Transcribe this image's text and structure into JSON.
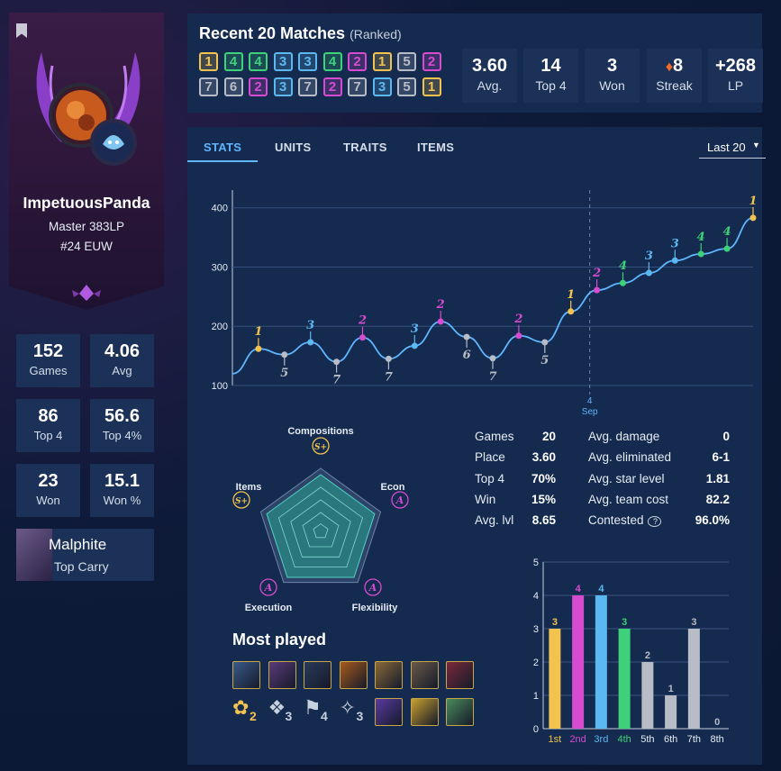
{
  "profile": {
    "name": "ImpetuousPanda",
    "rank": "Master 383LP",
    "ladder": "#24 EUW"
  },
  "profile_stats": [
    {
      "value": "152",
      "label": "Games"
    },
    {
      "value": "4.06",
      "label": "Avg"
    },
    {
      "value": "86",
      "label": "Top 4"
    },
    {
      "value": "56.6",
      "label": "Top 4%"
    },
    {
      "value": "23",
      "label": "Won"
    },
    {
      "value": "15.1",
      "label": "Won %"
    }
  ],
  "top_carry": {
    "name": "Malphite",
    "label": "Top Carry"
  },
  "recent": {
    "title": "Recent 20 Matches",
    "subtitle": "(Ranked)",
    "placements": [
      "1",
      "4",
      "4",
      "3",
      "3",
      "4",
      "2",
      "1",
      "5",
      "2",
      "7",
      "6",
      "2",
      "3",
      "7",
      "2",
      "7",
      "3",
      "5",
      "1"
    ]
  },
  "placement_colors": {
    "1": "#f2c34e",
    "2": "#d64bd0",
    "3": "#5cb8f0",
    "4": "#3ed17a",
    "5": "#b8bcc6",
    "6": "#b8bcc6",
    "7": "#b8bcc6",
    "8": "#b8bcc6"
  },
  "kpis": [
    {
      "value": "3.60",
      "label": "Avg."
    },
    {
      "value": "14",
      "label": "Top 4"
    },
    {
      "value": "3",
      "label": "Won"
    },
    {
      "value": "8",
      "label": "Streak",
      "icon": "fire-icon"
    },
    {
      "value": "+268",
      "label": "LP"
    }
  ],
  "tabs": [
    "STATS",
    "UNITS",
    "TRAITS",
    "ITEMS"
  ],
  "active_tab": "STATS",
  "range_select": "Last 20",
  "lp_chart": {
    "type": "line",
    "yticks": [
      "400",
      "300",
      "200",
      "100"
    ],
    "ylim": [
      100,
      430
    ],
    "date_label_day": "4",
    "date_label_month": "Sep",
    "lp": [
      120,
      162,
      152,
      173,
      140,
      181,
      145,
      167,
      208,
      182,
      146,
      184,
      173,
      225,
      261,
      273,
      290,
      311,
      322,
      331,
      383
    ],
    "placements": [
      null,
      "1",
      "5",
      "3",
      "7",
      "2",
      "7",
      "3",
      "2",
      "6",
      "7",
      "2",
      "5",
      "1",
      "2",
      "4",
      "3",
      "3",
      "4",
      "4",
      "1"
    ]
  },
  "radar": {
    "axes": [
      {
        "label": "Compositions",
        "grade": "S+"
      },
      {
        "label": "Econ",
        "grade": "A"
      },
      {
        "label": "Flexibility",
        "grade": "A"
      },
      {
        "label": "Execution",
        "grade": "A"
      },
      {
        "label": "Items",
        "grade": "S+"
      }
    ]
  },
  "stats_left": [
    {
      "label": "Games",
      "value": "20"
    },
    {
      "label": "Place",
      "value": "3.60"
    },
    {
      "label": "Top 4",
      "value": "70%"
    },
    {
      "label": "Win",
      "value": "15%"
    },
    {
      "label": "Avg. lvl",
      "value": "8.65"
    }
  ],
  "stats_right": [
    {
      "label": "Avg. damage",
      "value": "0"
    },
    {
      "label": "Avg. eliminated",
      "value": "6-1"
    },
    {
      "label": "Avg. star level",
      "value": "1.81"
    },
    {
      "label": "Avg. team cost",
      "value": "82.2"
    },
    {
      "label": "Contested",
      "value": "96.0%"
    }
  ],
  "most_played": {
    "title": "Most played",
    "trait_counts": [
      "2",
      "3",
      "4",
      "3"
    ]
  },
  "chart_data": {
    "type": "bar",
    "categories": [
      "1st",
      "2nd",
      "3rd",
      "4th",
      "5th",
      "6th",
      "7th",
      "8th"
    ],
    "values": [
      3,
      4,
      4,
      3,
      2,
      1,
      3,
      0
    ],
    "yticks": [
      "5",
      "4",
      "3",
      "2",
      "1",
      "0"
    ],
    "ylim": [
      0,
      5
    ],
    "colors": [
      "#f2c34e",
      "#d64bd0",
      "#5cb8f0",
      "#3ed17a",
      "#b8bcc6",
      "#b8bcc6",
      "#b8bcc6",
      "#b8bcc6"
    ]
  }
}
